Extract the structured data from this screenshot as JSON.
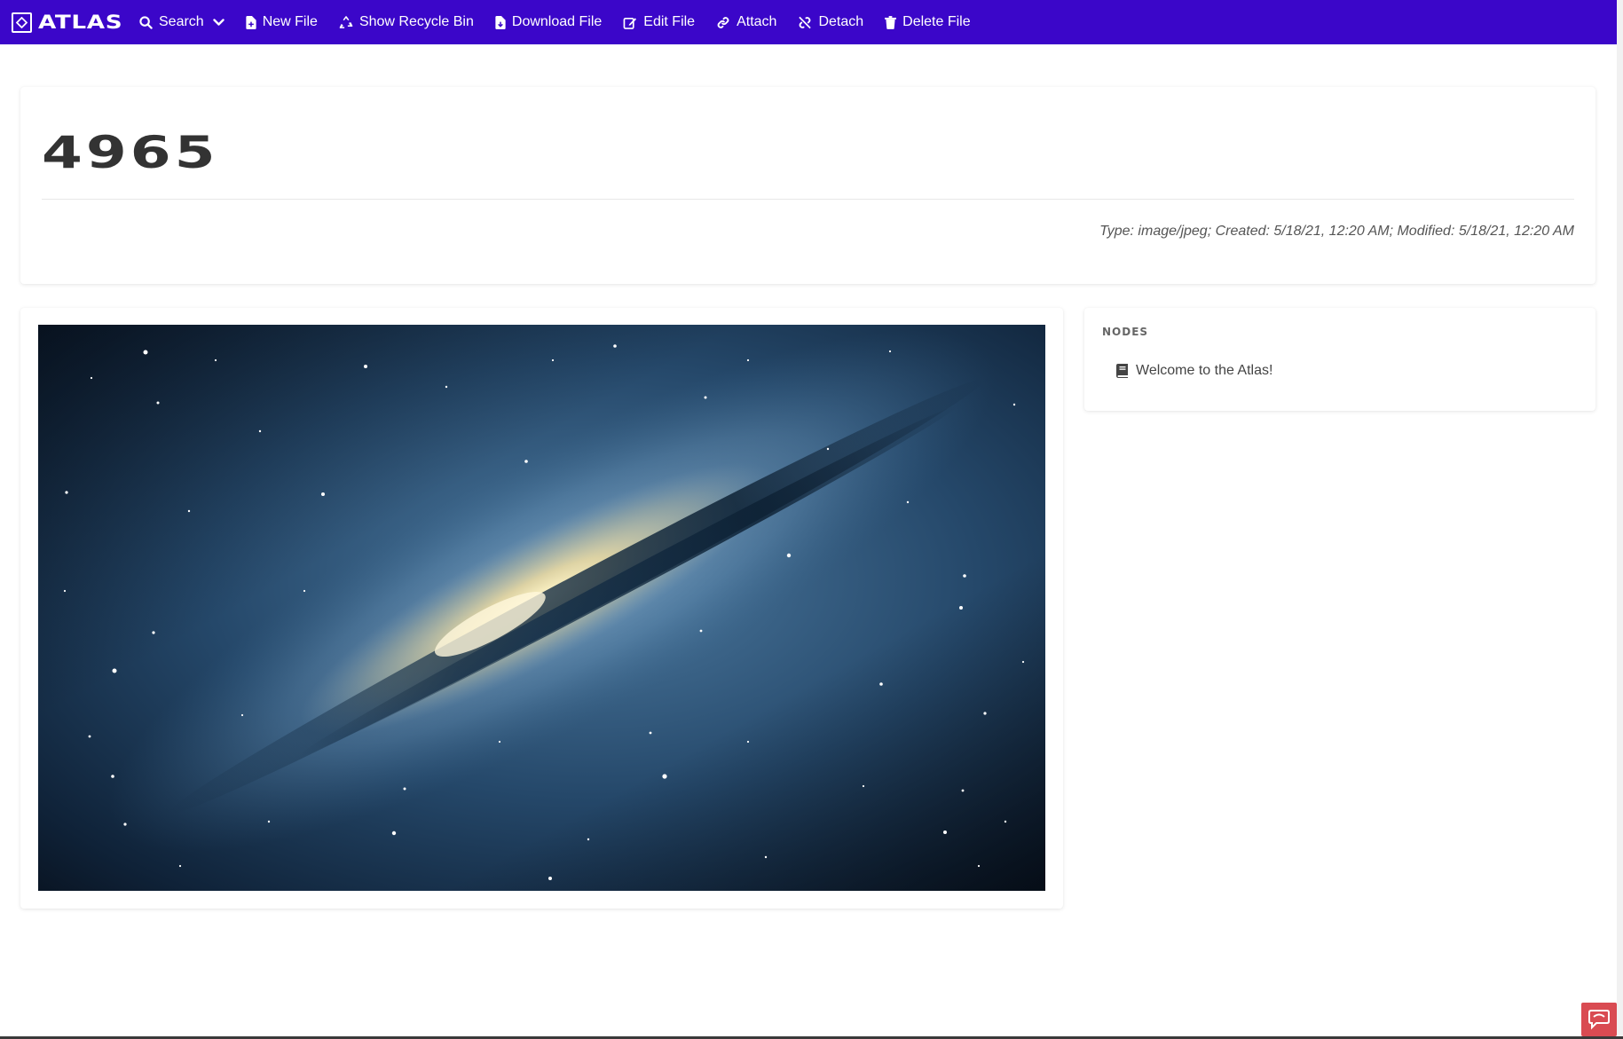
{
  "app": {
    "brand": "ATLAS",
    "accent": "#3b06c9"
  },
  "nav": {
    "search": "Search",
    "new_file": "New File",
    "show_recycle_bin": "Show Recycle Bin",
    "download_file": "Download File",
    "edit_file": "Edit File",
    "attach": "Attach",
    "detach": "Detach",
    "delete_file": "Delete File"
  },
  "file": {
    "title": "4965",
    "meta": "Type: image/jpeg; Created: 5/18/21, 12:20 AM; Modified: 5/18/21, 12:20 AM",
    "image_icon": "galaxy-image"
  },
  "nodes": {
    "heading": "NODES",
    "items": [
      {
        "label": "Welcome to the Atlas!",
        "icon": "book-icon"
      }
    ]
  }
}
